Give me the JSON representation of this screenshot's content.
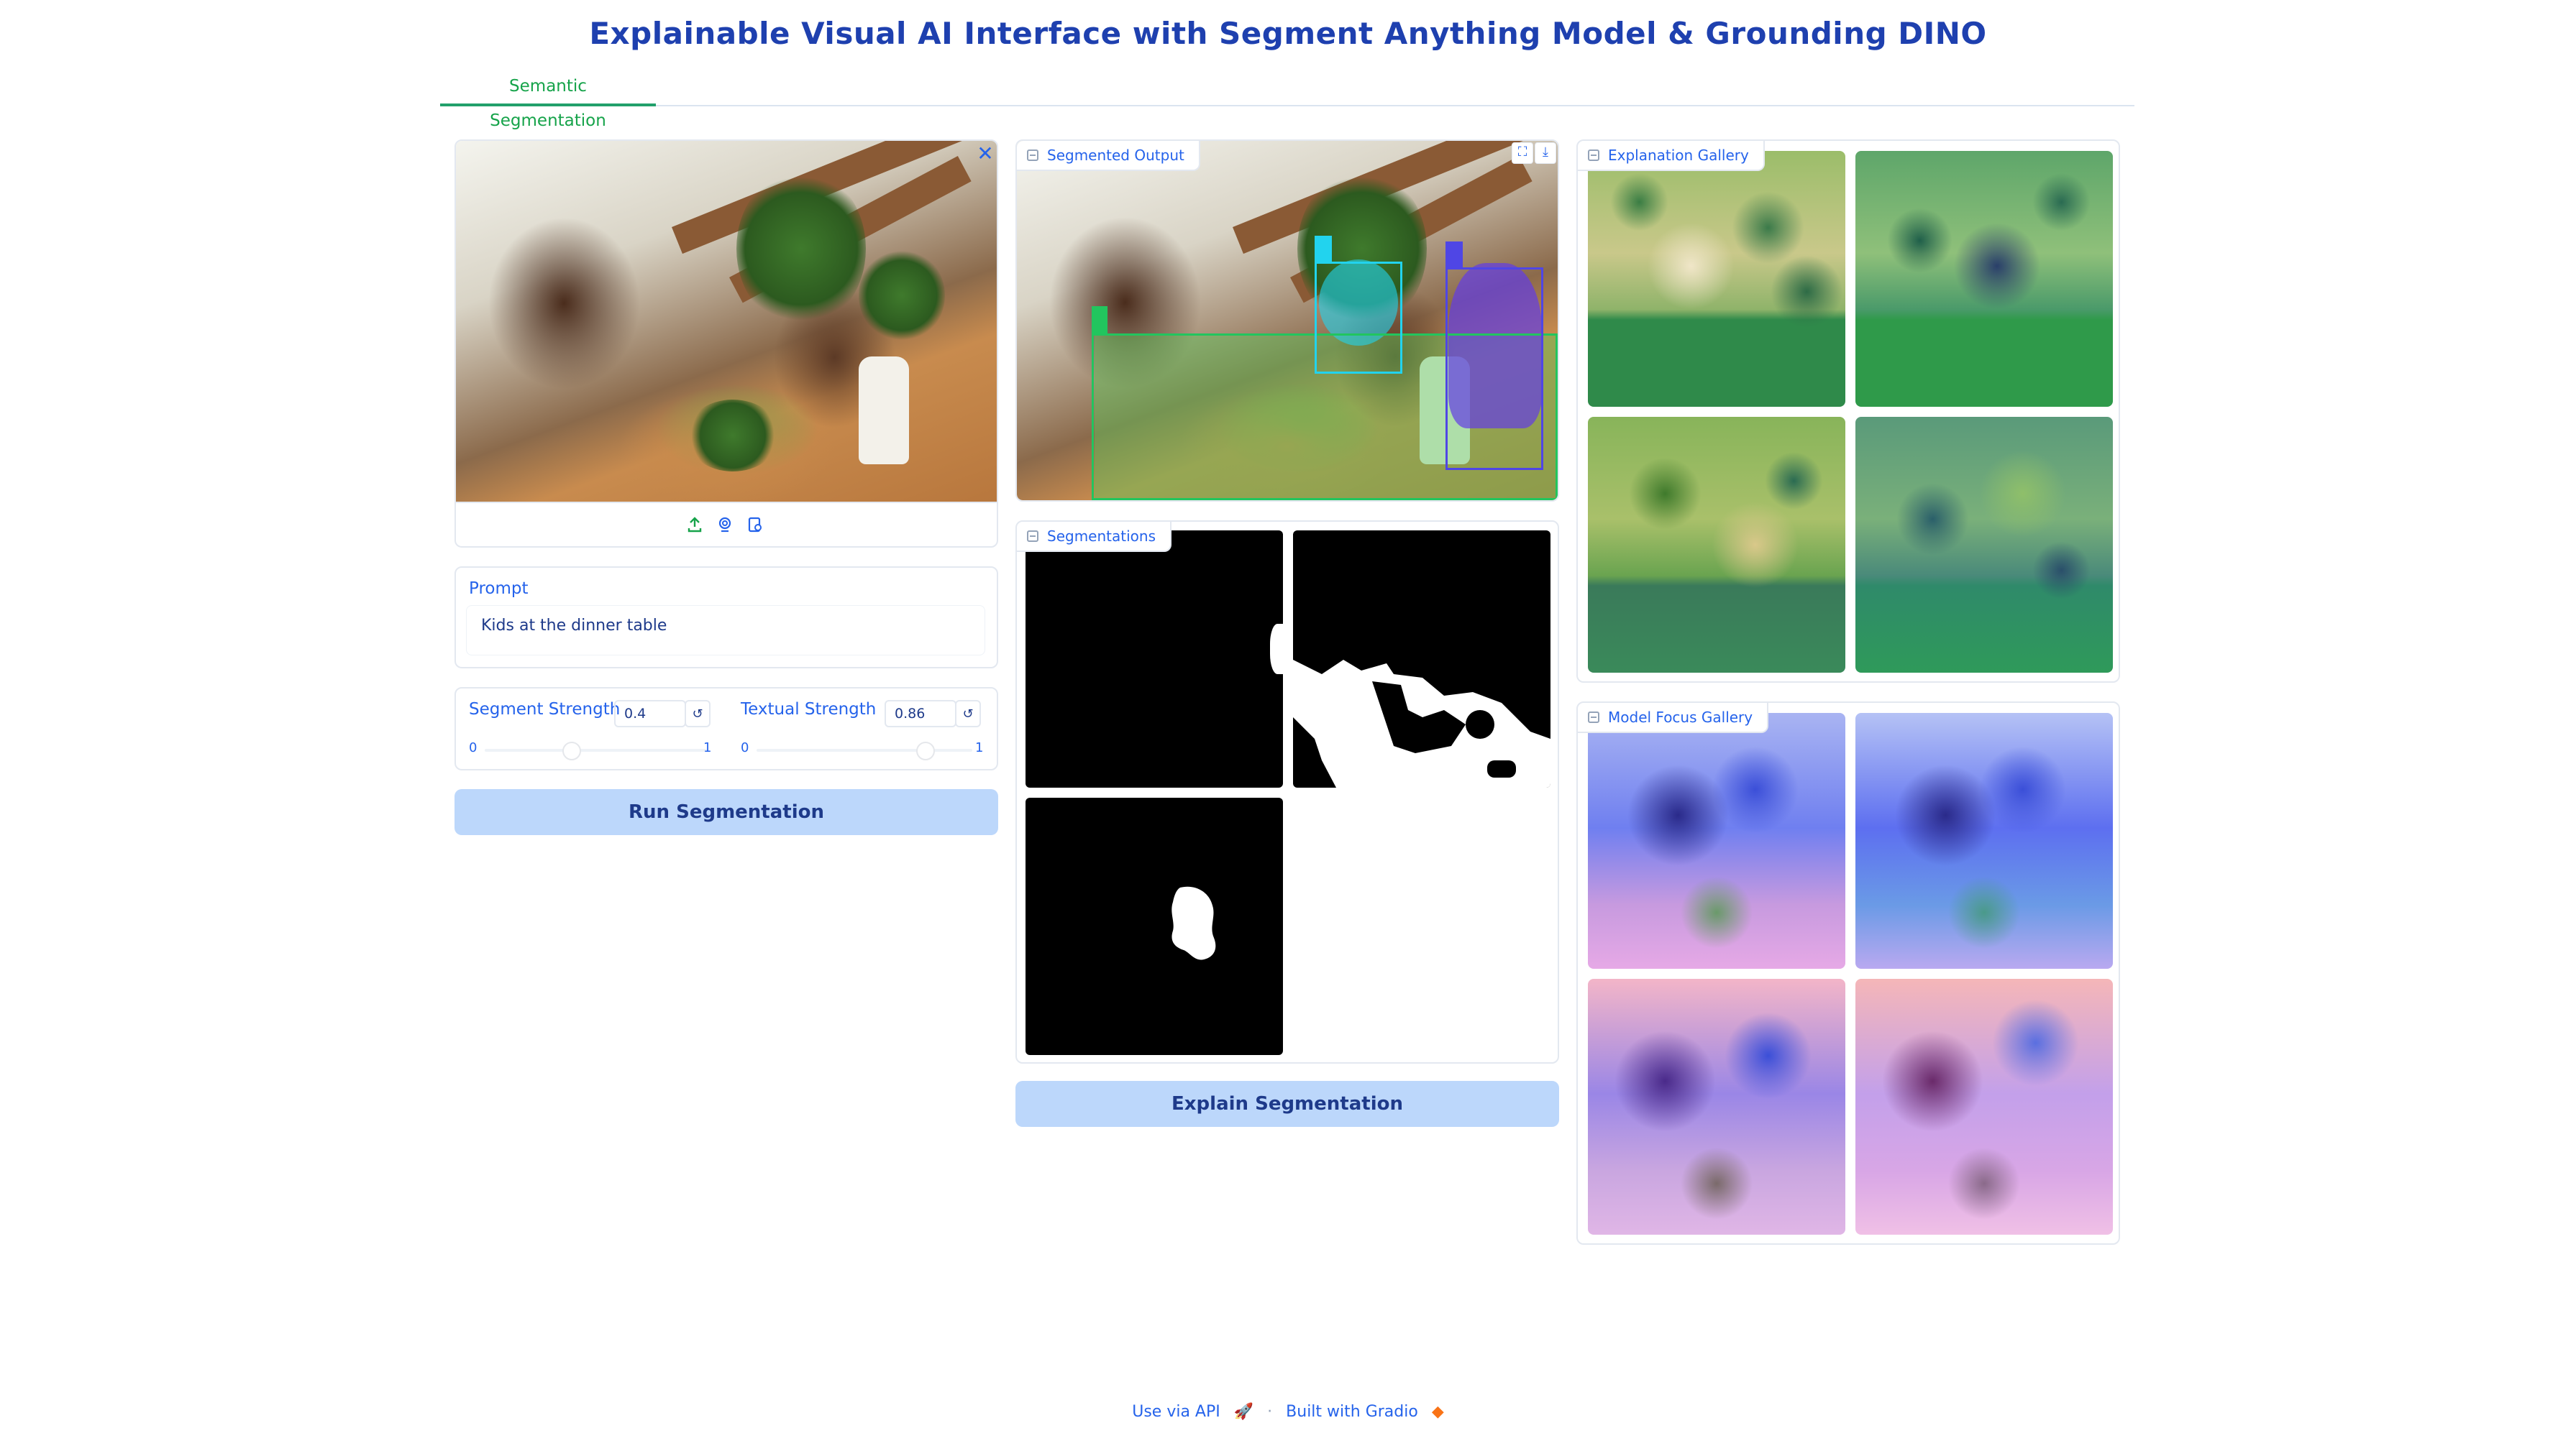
{
  "header": {
    "title": "Explainable Visual AI Interface with Segment Anything Model & Grounding DINO"
  },
  "tabs": [
    {
      "label": "Semantic Segmentation",
      "active": true
    }
  ],
  "input_panel": {
    "prompt_label": "Prompt",
    "prompt_value": "Kids at the dinner table",
    "segment_strength": {
      "label": "Segment Strength",
      "value": "0.4",
      "min": "0",
      "max": "1"
    },
    "textual_strength": {
      "label": "Textual Strength",
      "value": "0.86",
      "min": "0",
      "max": "1"
    },
    "run_button": "Run Segmentation",
    "reset_glyph": "↺"
  },
  "segmented_output": {
    "label": "Segmented Output"
  },
  "segmentations": {
    "label": "Segmentations"
  },
  "explain_button": "Explain Segmentation",
  "explanation_gallery": {
    "label": "Explanation Gallery"
  },
  "model_focus_gallery": {
    "label": "Model Focus Gallery"
  },
  "footer": {
    "api": "Use via API",
    "separator": "·",
    "built": "Built with Gradio"
  },
  "colors": {
    "accent": "#2563eb",
    "tab_active": "#16a34a",
    "button_bg": "#bcd7fb",
    "box_green": "#22c55e",
    "box_cyan": "#22d3ee",
    "box_purple": "#4f46e5"
  },
  "icons": [
    "close-icon",
    "upload-icon",
    "webcam-icon",
    "clipboard-icon",
    "fullscreen-icon",
    "download-icon",
    "image-label-icon",
    "rocket-icon",
    "gradio-logo-icon",
    "reset-icon"
  ]
}
